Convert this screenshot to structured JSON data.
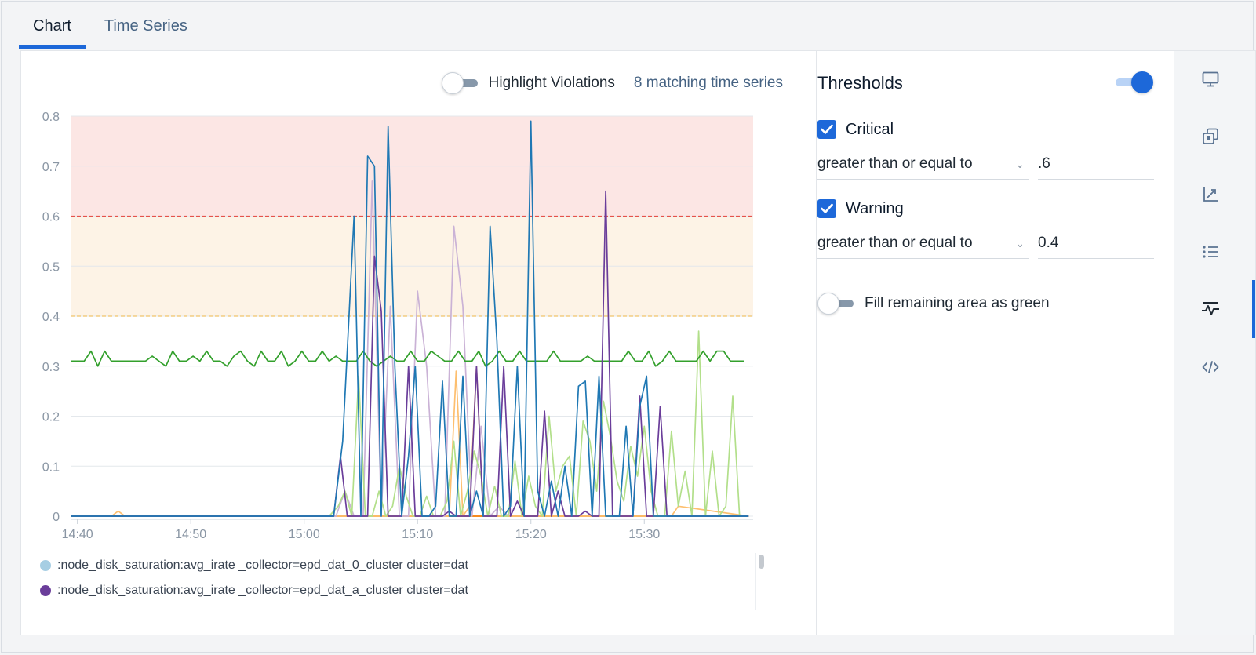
{
  "tabs": [
    {
      "label": "Chart",
      "active": true
    },
    {
      "label": "Time Series",
      "active": false
    }
  ],
  "topbar": {
    "highlight_violations_label": "Highlight Violations",
    "highlight_violations_on": false,
    "matching_label": "8 matching time series"
  },
  "thresholds": {
    "title": "Thresholds",
    "enabled": true,
    "critical": {
      "label": "Critical",
      "checked": true,
      "operator": "greater than or equal to",
      "value": ".6"
    },
    "warning": {
      "label": "Warning",
      "checked": true,
      "operator": "greater than or equal to",
      "value": "0.4"
    },
    "fill_green_label": "Fill remaining area as green",
    "fill_green_on": false
  },
  "rail_icons": [
    "monitor-icon",
    "copy-icon",
    "axis-icon",
    "list-icon",
    "threshold-icon",
    "code-icon"
  ],
  "rail_active": "threshold-icon",
  "colors": {
    "accent": "#1d68d9",
    "critical_fill": "#fce6e4",
    "warning_fill": "#fdf3e6",
    "critical_line": "#e5534b",
    "warning_line": "#f0c36b"
  },
  "legend": [
    {
      "label": ":node_disk_saturation:avg_irate _collector=epd_dat_0_cluster cluster=dat",
      "color": "#a6cee3"
    },
    {
      "label": ":node_disk_saturation:avg_irate _collector=epd_dat_a_cluster cluster=dat",
      "color": "#6a3d9a"
    }
  ],
  "chart_data": {
    "type": "line",
    "ylim": [
      0,
      0.8
    ],
    "yticks": [
      "0",
      "0.1",
      "0.2",
      "0.3",
      "0.4",
      "0.5",
      "0.6",
      "0.7",
      "0.8"
    ],
    "xticks": [
      "14:40",
      "14:50",
      "15:00",
      "15:10",
      "15:20",
      "15:30"
    ],
    "xtick_minutes": [
      3,
      13,
      23,
      33,
      43,
      53
    ],
    "x_range_minutes": [
      2.4,
      62.6
    ],
    "thresholds": {
      "critical": 0.6,
      "warning": 0.4
    },
    "series": [
      {
        "color": "#33a02c",
        "x": [
          2.4,
          3.0,
          3.6,
          4.2,
          4.8,
          5.4,
          6.0,
          6.6,
          7.2,
          7.8,
          8.4,
          9.0,
          9.6,
          10.2,
          10.8,
          11.4,
          12.0,
          12.6,
          13.2,
          13.8,
          14.4,
          15.0,
          15.6,
          16.2,
          16.8,
          17.4,
          18.0,
          18.6,
          19.2,
          19.8,
          20.4,
          21.0,
          21.6,
          22.2,
          22.8,
          23.4,
          24.0,
          24.6,
          25.2,
          25.8,
          26.4,
          27.0,
          27.6,
          28.2,
          28.8,
          29.4,
          30.0,
          30.6,
          31.2,
          31.8,
          32.4,
          33.0,
          33.6,
          34.2,
          34.8,
          35.4,
          36.0,
          36.6,
          37.2,
          37.8,
          38.4,
          39.0,
          39.6,
          40.2,
          40.8,
          41.4,
          42.0,
          42.6,
          43.2,
          43.8,
          44.4,
          45.0,
          45.6,
          46.2,
          46.8,
          47.4,
          48.0,
          48.6,
          49.2,
          49.8,
          50.4,
          51.0,
          51.6,
          52.2,
          52.8,
          53.4,
          54.0,
          54.6,
          55.2,
          55.8,
          56.4,
          57.0,
          57.6,
          58.2,
          58.8,
          59.4,
          60.0,
          60.6,
          61.2,
          61.8
        ],
        "y": [
          0.31,
          0.31,
          0.31,
          0.33,
          0.3,
          0.33,
          0.31,
          0.31,
          0.31,
          0.31,
          0.31,
          0.31,
          0.32,
          0.31,
          0.3,
          0.33,
          0.31,
          0.31,
          0.32,
          0.31,
          0.33,
          0.31,
          0.31,
          0.3,
          0.32,
          0.33,
          0.31,
          0.3,
          0.33,
          0.31,
          0.31,
          0.33,
          0.3,
          0.31,
          0.33,
          0.31,
          0.31,
          0.33,
          0.31,
          0.32,
          0.31,
          0.31,
          0.31,
          0.33,
          0.31,
          0.3,
          0.31,
          0.32,
          0.31,
          0.31,
          0.33,
          0.31,
          0.31,
          0.33,
          0.32,
          0.31,
          0.31,
          0.33,
          0.31,
          0.31,
          0.33,
          0.3,
          0.31,
          0.33,
          0.31,
          0.31,
          0.33,
          0.31,
          0.31,
          0.31,
          0.31,
          0.33,
          0.31,
          0.31,
          0.31,
          0.31,
          0.32,
          0.31,
          0.31,
          0.31,
          0.31,
          0.31,
          0.33,
          0.31,
          0.31,
          0.33,
          0.3,
          0.31,
          0.33,
          0.31,
          0.31,
          0.31,
          0.31,
          0.33,
          0.31,
          0.33,
          0.33,
          0.31,
          0.31,
          0.31
        ]
      },
      {
        "color": "#1f78b4",
        "x": [
          2.4,
          10.0,
          20.0,
          25.6,
          26.4,
          27.4,
          28.0,
          28.6,
          29.2,
          29.8,
          30.4,
          31.0,
          31.6,
          32.2,
          32.8,
          33.4,
          34.0,
          34.6,
          35.2,
          35.8,
          36.4,
          37.0,
          37.6,
          38.2,
          38.8,
          39.4,
          40.0,
          40.6,
          41.2,
          41.8,
          42.4,
          43.0,
          43.6,
          44.2,
          44.8,
          45.4,
          46.0,
          46.6,
          47.2,
          47.8,
          48.4,
          49.0,
          49.6,
          50.2,
          50.8,
          51.4,
          52.0,
          52.6,
          53.2,
          53.8,
          54.4,
          62.2
        ],
        "y": [
          0.0,
          0.0,
          0.0,
          0.0,
          0.15,
          0.6,
          0.0,
          0.72,
          0.7,
          0.0,
          0.78,
          0.3,
          0.0,
          0.12,
          0.3,
          0.0,
          0.0,
          0.02,
          0.27,
          0.0,
          0.0,
          0.28,
          0.0,
          0.05,
          0.0,
          0.58,
          0.35,
          0.0,
          0.02,
          0.3,
          0.0,
          0.79,
          0.05,
          0.0,
          0.07,
          0.0,
          0.1,
          0.0,
          0.26,
          0.27,
          0.0,
          0.28,
          0.0,
          0.0,
          0.0,
          0.18,
          0.0,
          0.22,
          0.28,
          0.0,
          0.0,
          0.0
        ]
      },
      {
        "color": "#6a3d9a",
        "x": [
          2.4,
          10.0,
          20.0,
          24.8,
          25.6,
          26.2,
          26.8,
          27.4,
          28.0,
          28.6,
          29.2,
          29.8,
          30.4,
          31.0,
          31.6,
          32.2,
          32.8,
          33.4,
          34.0,
          34.6,
          35.2,
          35.8,
          36.4,
          37.0,
          37.6,
          38.2,
          38.8,
          39.4,
          40.0,
          40.6,
          41.2,
          41.8,
          42.4,
          43.0,
          43.6,
          44.2,
          44.8,
          45.4,
          46.0,
          46.6,
          47.2,
          47.8,
          48.4,
          49.0,
          49.6,
          50.2,
          50.8,
          51.4,
          52.0,
          52.6,
          53.2,
          53.8,
          54.4,
          55.0,
          55.6,
          56.2,
          56.8,
          57.4,
          58.0,
          58.6,
          59.2,
          59.8,
          60.4,
          61.0,
          61.6,
          62.2
        ],
        "y": [
          0.0,
          0.0,
          0.0,
          0.0,
          0.0,
          0.12,
          0.0,
          0.0,
          0.0,
          0.0,
          0.52,
          0.41,
          0.0,
          0.0,
          0.0,
          0.3,
          0.0,
          0.0,
          0.0,
          0.0,
          0.0,
          0.01,
          0.0,
          0.0,
          0.0,
          0.3,
          0.0,
          0.0,
          0.0,
          0.3,
          0.0,
          0.03,
          0.0,
          0.0,
          0.0,
          0.21,
          0.0,
          0.05,
          0.0,
          0.0,
          0.0,
          0.01,
          0.0,
          0.0,
          0.65,
          0.0,
          0.0,
          0.0,
          0.0,
          0.24,
          0.0,
          0.0,
          0.22,
          0.0,
          0.0,
          0.0,
          0.0,
          0.0,
          0.0,
          0.0,
          0.0,
          0.0,
          0.0,
          0.0,
          0.0,
          0.0
        ]
      },
      {
        "color": "#b2df8a",
        "x": [
          25.2,
          26.0,
          26.6,
          27.2,
          27.8,
          28.4,
          29.0,
          29.6,
          30.2,
          30.8,
          31.4,
          32.0,
          32.6,
          33.2,
          33.8,
          34.4,
          35.0,
          35.6,
          36.2,
          36.8,
          37.4,
          38.0,
          38.6,
          39.2,
          39.8,
          40.4,
          41.0,
          41.6,
          42.2,
          42.8,
          43.4,
          44.0,
          44.6,
          45.2,
          45.8,
          46.4,
          47.0,
          47.6,
          48.2,
          48.8,
          49.4,
          50.0,
          50.6,
          51.2,
          51.8,
          52.4,
          53.0,
          53.6,
          54.2,
          54.8,
          55.4,
          56.0,
          56.6,
          57.2,
          57.8,
          58.4,
          59.0,
          59.6,
          60.2,
          60.8,
          61.4,
          62.0
        ],
        "y": [
          0.0,
          0.02,
          0.05,
          0.0,
          0.28,
          0.0,
          0.0,
          0.05,
          0.0,
          0.02,
          0.1,
          0.04,
          0.0,
          0.0,
          0.04,
          0.0,
          0.0,
          0.03,
          0.15,
          0.0,
          0.05,
          0.13,
          0.08,
          0.0,
          0.06,
          0.0,
          0.0,
          0.11,
          0.0,
          0.08,
          0.02,
          0.0,
          0.2,
          0.05,
          0.1,
          0.12,
          0.0,
          0.19,
          0.15,
          0.05,
          0.23,
          0.16,
          0.07,
          0.03,
          0.14,
          0.08,
          0.18,
          0.05,
          0.0,
          0.0,
          0.17,
          0.02,
          0.09,
          0.0,
          0.37,
          0.0,
          0.13,
          0.0,
          0.02,
          0.24,
          0.0,
          0.0
        ]
      },
      {
        "color": "#cab2d6",
        "x": [
          25.0,
          25.8,
          26.6,
          27.4,
          28.2,
          29.0,
          29.8,
          30.6,
          31.4,
          32.2,
          33.0,
          33.8,
          34.6,
          35.4,
          36.2,
          37.0,
          37.8,
          38.6,
          39.4,
          40.2,
          41.0
        ],
        "y": [
          0.0,
          0.0,
          0.05,
          0.0,
          0.0,
          0.67,
          0.0,
          0.42,
          0.0,
          0.0,
          0.45,
          0.3,
          0.0,
          0.0,
          0.58,
          0.42,
          0.0,
          0.18,
          0.0,
          0.02,
          0.0
        ]
      },
      {
        "color": "#fdbf6f",
        "x": [
          2.4,
          6.0,
          6.6,
          7.2,
          20.0,
          30.0,
          31.0,
          32.0,
          33.0,
          34.0,
          35.0,
          35.8,
          36.4,
          37.0,
          37.6,
          38.2,
          38.8,
          39.4,
          40.0,
          41.0,
          50.0,
          55.4,
          56.0,
          62.2
        ],
        "y": [
          0.0,
          0.0,
          0.01,
          0.0,
          0.0,
          0.0,
          0.0,
          0.0,
          0.0,
          0.0,
          0.0,
          0.0,
          0.29,
          0.0,
          0.02,
          0.3,
          0.0,
          0.0,
          0.0,
          0.0,
          0.0,
          0.0,
          0.02,
          0.0
        ]
      },
      {
        "color": "#ff7f00",
        "x": [
          2.4,
          62.2
        ],
        "y": [
          0.0,
          0.0
        ]
      },
      {
        "color": "#a6cee3",
        "x": [
          2.4,
          62.2
        ],
        "y": [
          0.0,
          0.0
        ]
      }
    ]
  }
}
